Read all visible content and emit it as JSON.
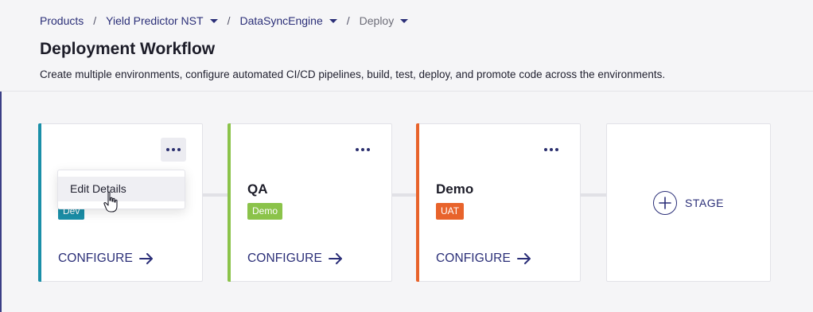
{
  "breadcrumb": [
    {
      "label": "Products",
      "has_dropdown": false
    },
    {
      "label": "Yield Predictor NST",
      "has_dropdown": true
    },
    {
      "label": "DataSyncEngine",
      "has_dropdown": true
    },
    {
      "label": "Deploy",
      "has_dropdown": true,
      "current": true
    }
  ],
  "breadcrumb_separator": "/",
  "page": {
    "title": "Deployment Workflow",
    "subtitle": "Create multiple environments, configure automated CI/CD pipelines, build, test, deploy, and promote code across the environments."
  },
  "stages": [
    {
      "name": "",
      "tag": "Dev",
      "accent_color": "#1a8fa8",
      "tag_color": "#1a8fa8",
      "configure_label": "CONFIGURE",
      "menu_open": true
    },
    {
      "name": "QA",
      "tag": "Demo",
      "accent_color": "#8bc34a",
      "tag_color": "#8bc34a",
      "configure_label": "CONFIGURE",
      "menu_open": false
    },
    {
      "name": "Demo",
      "tag": "UAT",
      "accent_color": "#e8632b",
      "tag_color": "#e8632b",
      "configure_label": "CONFIGURE",
      "menu_open": false
    }
  ],
  "add_stage": {
    "label": "STAGE",
    "icon": "plus-circle-icon"
  },
  "context_menu": {
    "items": [
      {
        "label": "Edit Details"
      }
    ]
  },
  "icons": {
    "more": "more-horizontal-icon",
    "arrow": "arrow-right-icon",
    "caret": "caret-down-icon",
    "cursor": "hand-pointer-icon"
  },
  "colors": {
    "brand": "#2b2f78",
    "background": "#f5f5f7"
  }
}
